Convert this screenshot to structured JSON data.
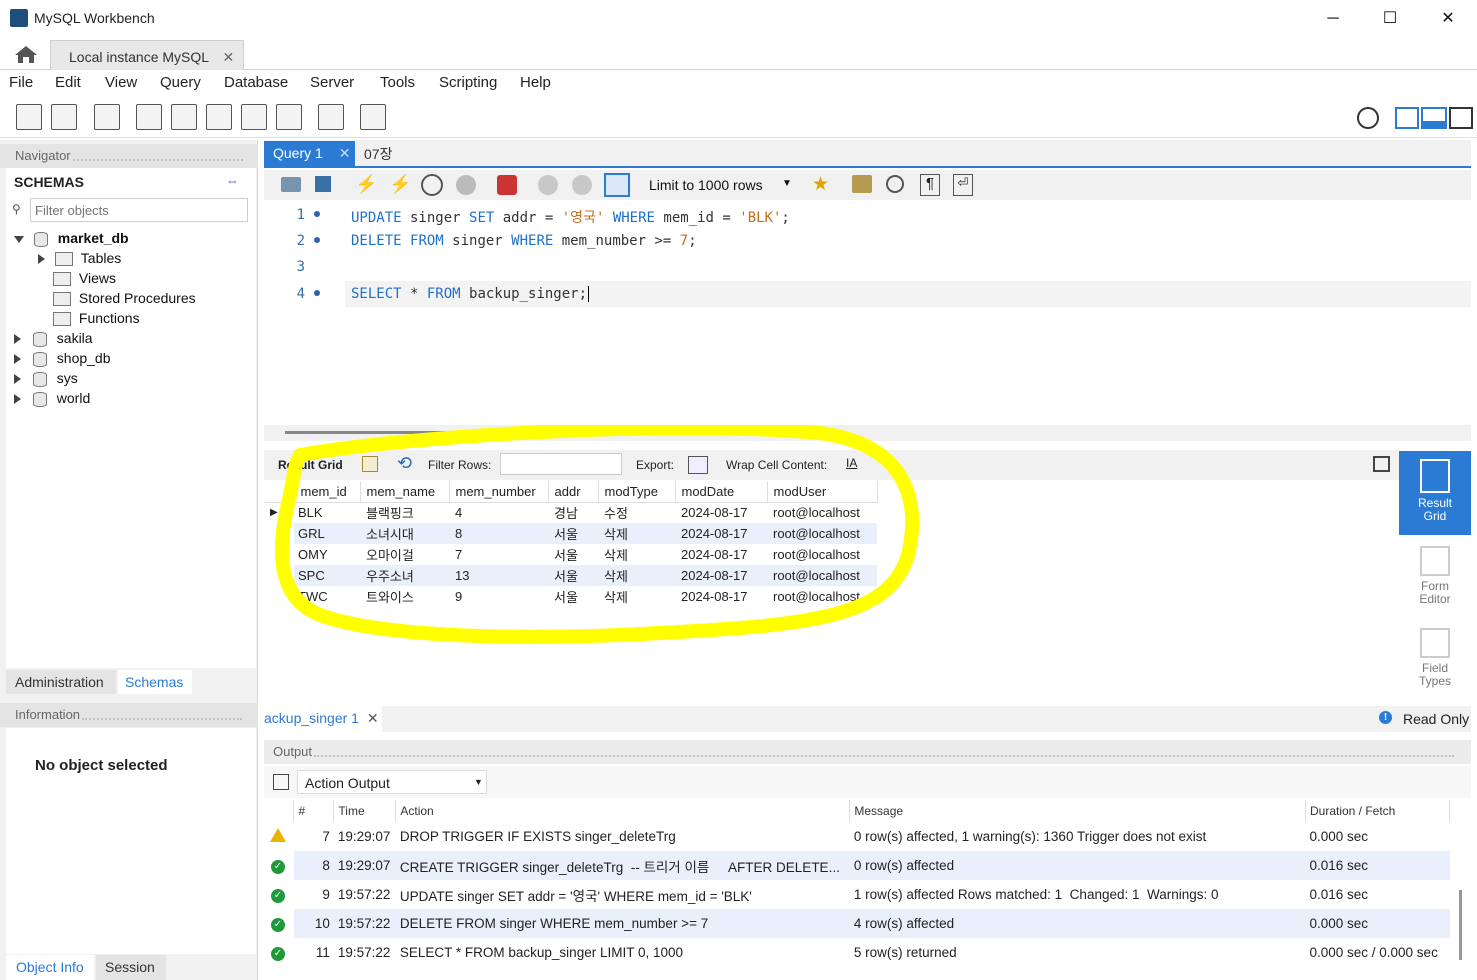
{
  "window": {
    "title": "MySQL Workbench",
    "minimize": "─",
    "maximize": "☐",
    "close": "✕"
  },
  "conn_tab": {
    "label": "Local instance MySQL",
    "close": "✕"
  },
  "menu": [
    "File",
    "Edit",
    "View",
    "Query",
    "Database",
    "Server",
    "Tools",
    "Scripting",
    "Help"
  ],
  "navigator": {
    "title": "Navigator",
    "schemas_label": "SCHEMAS",
    "filter_placeholder": "Filter objects",
    "tree": {
      "market_db": "market_db",
      "children": [
        "Tables",
        "Views",
        "Stored Procedures",
        "Functions"
      ],
      "others": [
        "sakila",
        "shop_db",
        "sys",
        "world"
      ]
    },
    "tabs": {
      "administration": "Administration",
      "schemas": "Schemas"
    },
    "information_title": "Information",
    "no_object": "No object selected",
    "bottom_tabs": {
      "object_info": "Object Info",
      "session": "Session"
    }
  },
  "editor_tabs": {
    "active": "Query 1",
    "close": "✕",
    "other": "07장"
  },
  "editor_toolbar": {
    "limit_label": "Limit to 1000 rows"
  },
  "code": {
    "line_numbers": [
      "1",
      "2",
      "3",
      "4"
    ],
    "l1": {
      "kw1": "UPDATE",
      "t1": " singer ",
      "kw2": "SET",
      "t2": " addr = ",
      "s1": "'영국'",
      "t3": " ",
      "kw3": "WHERE",
      "t4": " mem_id = ",
      "s2": "'BLK'",
      "t5": ";"
    },
    "l2": {
      "kw1": "DELETE",
      "t1": " ",
      "kw2": "FROM",
      "t2": " singer ",
      "kw3": "WHERE",
      "t3": " mem_number >= ",
      "n1": "7",
      "t4": ";"
    },
    "l4": {
      "kw1": "SELECT",
      "t1": " * ",
      "kw2": "FROM",
      "t2": " backup_singer;"
    }
  },
  "result_toolbar": {
    "result_grid": "Result Grid",
    "filter_rows": "Filter Rows:",
    "export": "Export:",
    "wrap": "Wrap Cell Content:"
  },
  "grid": {
    "columns": [
      "mem_id",
      "mem_name",
      "mem_number",
      "addr",
      "modType",
      "modDate",
      "modUser"
    ],
    "rows": [
      [
        "BLK",
        "블랙핑크",
        "4",
        "경남",
        "수정",
        "2024-08-17",
        "root@localhost"
      ],
      [
        "GRL",
        "소녀시대",
        "8",
        "서울",
        "삭제",
        "2024-08-17",
        "root@localhost"
      ],
      [
        "OMY",
        "오마이걸",
        "7",
        "서울",
        "삭제",
        "2024-08-17",
        "root@localhost"
      ],
      [
        "SPC",
        "우주소녀",
        "13",
        "서울",
        "삭제",
        "2024-08-17",
        "root@localhost"
      ],
      [
        "TWC",
        "트와이스",
        "9",
        "서울",
        "삭제",
        "2024-08-17",
        "root@localhost"
      ]
    ]
  },
  "right_panel": {
    "result_grid": "Result Grid",
    "form_editor": "Form Editor",
    "field_types": "Field Types"
  },
  "result_tab": {
    "label": "ackup_singer 1",
    "close": "✕",
    "read_only": "Read Only"
  },
  "output": {
    "title": "Output",
    "selector": "Action Output",
    "columns": [
      "",
      "#",
      "Time",
      "Action",
      "Message",
      "Duration / Fetch"
    ],
    "rows": [
      {
        "status": "warn",
        "num": "7",
        "time": "19:29:07",
        "action": "DROP TRIGGER IF EXISTS singer_deleteTrg",
        "message": "0 row(s) affected, 1 warning(s): 1360 Trigger does not exist",
        "duration": "0.000 sec"
      },
      {
        "status": "ok",
        "num": "8",
        "time": "19:29:07",
        "action": "CREATE TRIGGER singer_deleteTrg  -- 트리거 이름     AFTER DELETE...",
        "message": "0 row(s) affected",
        "duration": "0.016 sec"
      },
      {
        "status": "ok",
        "num": "9",
        "time": "19:57:22",
        "action": "UPDATE singer SET addr = '영국' WHERE mem_id = 'BLK'",
        "message": "1 row(s) affected Rows matched: 1  Changed: 1  Warnings: 0",
        "duration": "0.016 sec"
      },
      {
        "status": "ok",
        "num": "10",
        "time": "19:57:22",
        "action": "DELETE FROM singer WHERE mem_number >= 7",
        "message": "4 row(s) affected",
        "duration": "0.000 sec"
      },
      {
        "status": "ok",
        "num": "11",
        "time": "19:57:22",
        "action": "SELECT * FROM backup_singer LIMIT 0, 1000",
        "message": "5 row(s) returned",
        "duration": "0.000 sec / 0.000 sec"
      }
    ]
  },
  "colors": {
    "accent": "#2b7bd5",
    "highlight": "#ffff00"
  }
}
